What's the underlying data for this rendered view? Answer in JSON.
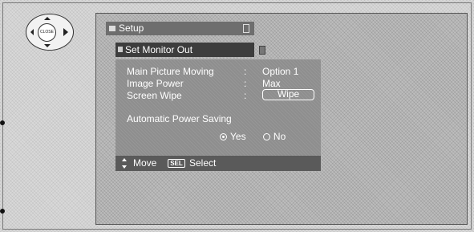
{
  "remote": {
    "center_label": "CLOSE"
  },
  "setup": {
    "title": "Setup",
    "submenu_title": "Set Monitor Out",
    "rows": [
      {
        "label": "Main Picture Moving",
        "colon": ":",
        "value": "Option 1"
      },
      {
        "label": "Image Power",
        "colon": ":",
        "value": "Max"
      },
      {
        "label": "Screen Wipe",
        "colon": ":",
        "button": "Wipe"
      }
    ],
    "auto_power": {
      "label": "Automatic Power Saving",
      "options": [
        {
          "label": "Yes",
          "selected": true
        },
        {
          "label": "No",
          "selected": false
        }
      ]
    },
    "footer": {
      "move_label": "Move",
      "sel_badge": "SEL",
      "select_label": "Select"
    }
  }
}
